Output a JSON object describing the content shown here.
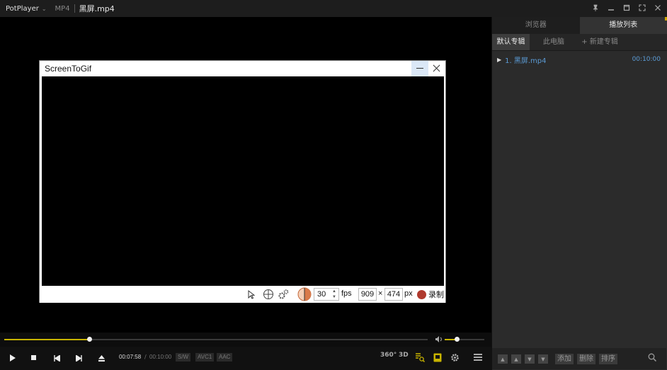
{
  "titlebar": {
    "app_name": "PotPlayer",
    "format": "MP4",
    "filename": "黑屏.mp4"
  },
  "stg": {
    "title": "ScreenToGif",
    "fps_value": "30",
    "fps_label": "fps",
    "width_value": "909",
    "times": "×",
    "height_value": "474",
    "px_label": "px",
    "record_label": "录制"
  },
  "playback": {
    "current_time": "00:07:58",
    "separator": "/",
    "total_time": "00:10:00",
    "progress_fraction": 0.2,
    "volume_fraction": 0.3,
    "tags": [
      "S/W",
      "AVC1",
      "AAC"
    ],
    "right_icons": [
      "360°",
      "3D"
    ]
  },
  "panel": {
    "tabs": [
      "浏览器",
      "播放列表"
    ],
    "subtabs": [
      "默认专辑",
      "此电脑",
      "+ 新建专辑"
    ],
    "playlist": [
      {
        "name": "1. 黑屏.mp4",
        "duration": "00:10:00"
      }
    ],
    "buttons": [
      "添加",
      "删除",
      "排序"
    ]
  },
  "colors": {
    "accent": "#c8b400",
    "link": "#5b9bd5",
    "record": "#b03a2e"
  }
}
